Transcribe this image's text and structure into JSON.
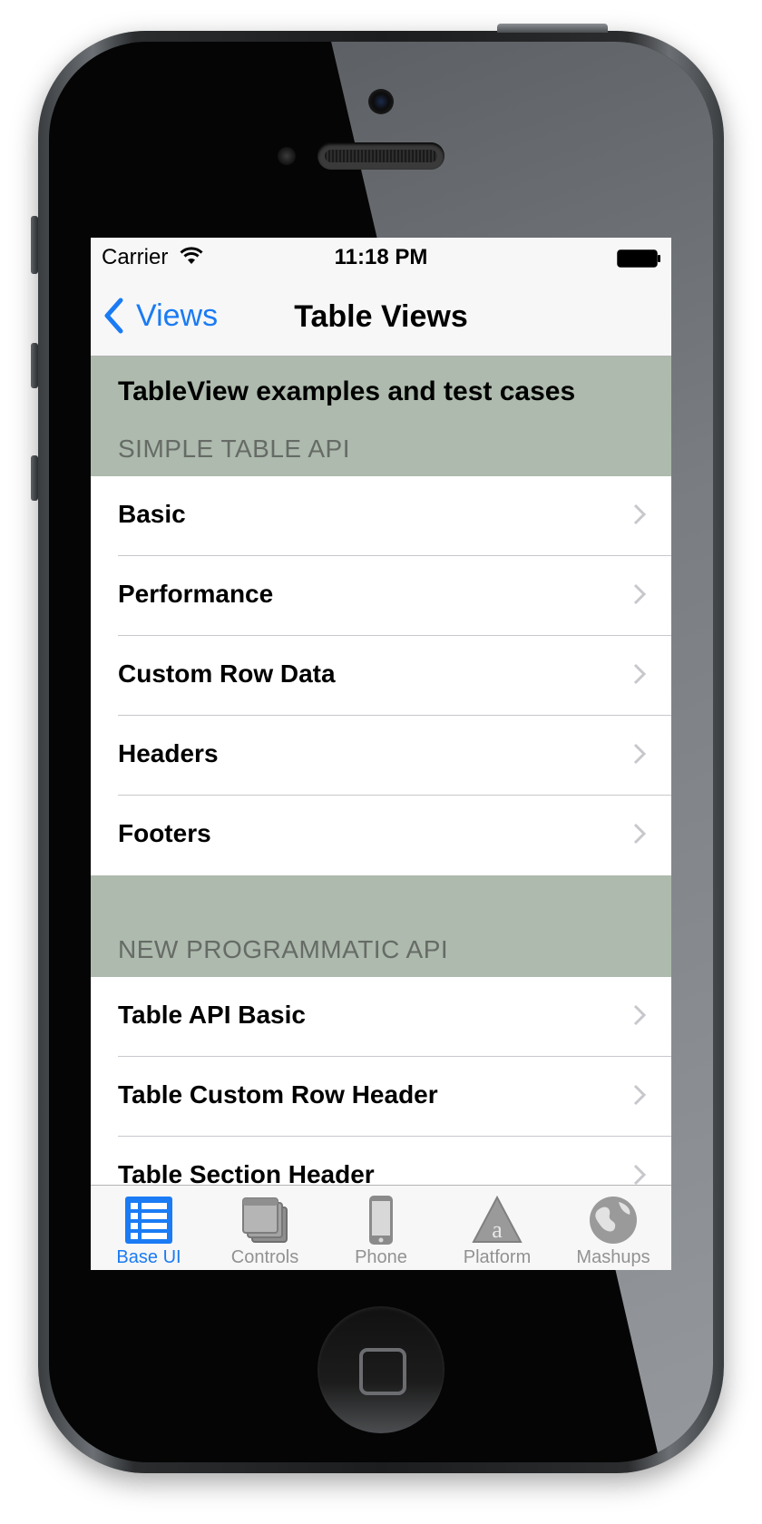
{
  "status_bar": {
    "carrier": "Carrier",
    "time": "11:18 PM"
  },
  "nav": {
    "back_label": "Views",
    "title": "Table Views"
  },
  "sections": [
    {
      "title": "TableView examples and test cases",
      "subtitle": "SIMPLE TABLE API",
      "rows": [
        "Basic",
        "Performance",
        "Custom Row Data",
        "Headers",
        "Footers"
      ]
    },
    {
      "title": "",
      "subtitle": "NEW PROGRAMMATIC API",
      "rows": [
        "Table API Basic",
        "Table Custom Row Header",
        "Table Section Header"
      ]
    }
  ],
  "tabs": [
    {
      "label": "Base UI",
      "icon": "list-icon",
      "active": true
    },
    {
      "label": "Controls",
      "icon": "windows-icon",
      "active": false
    },
    {
      "label": "Phone",
      "icon": "phone-icon",
      "active": false
    },
    {
      "label": "Platform",
      "icon": "platform-icon",
      "active": false
    },
    {
      "label": "Mashups",
      "icon": "globe-icon",
      "active": false
    }
  ],
  "colors": {
    "accent": "#1a7bf4",
    "section_header_bg": "#adbaad",
    "tab_inactive": "#929292"
  }
}
